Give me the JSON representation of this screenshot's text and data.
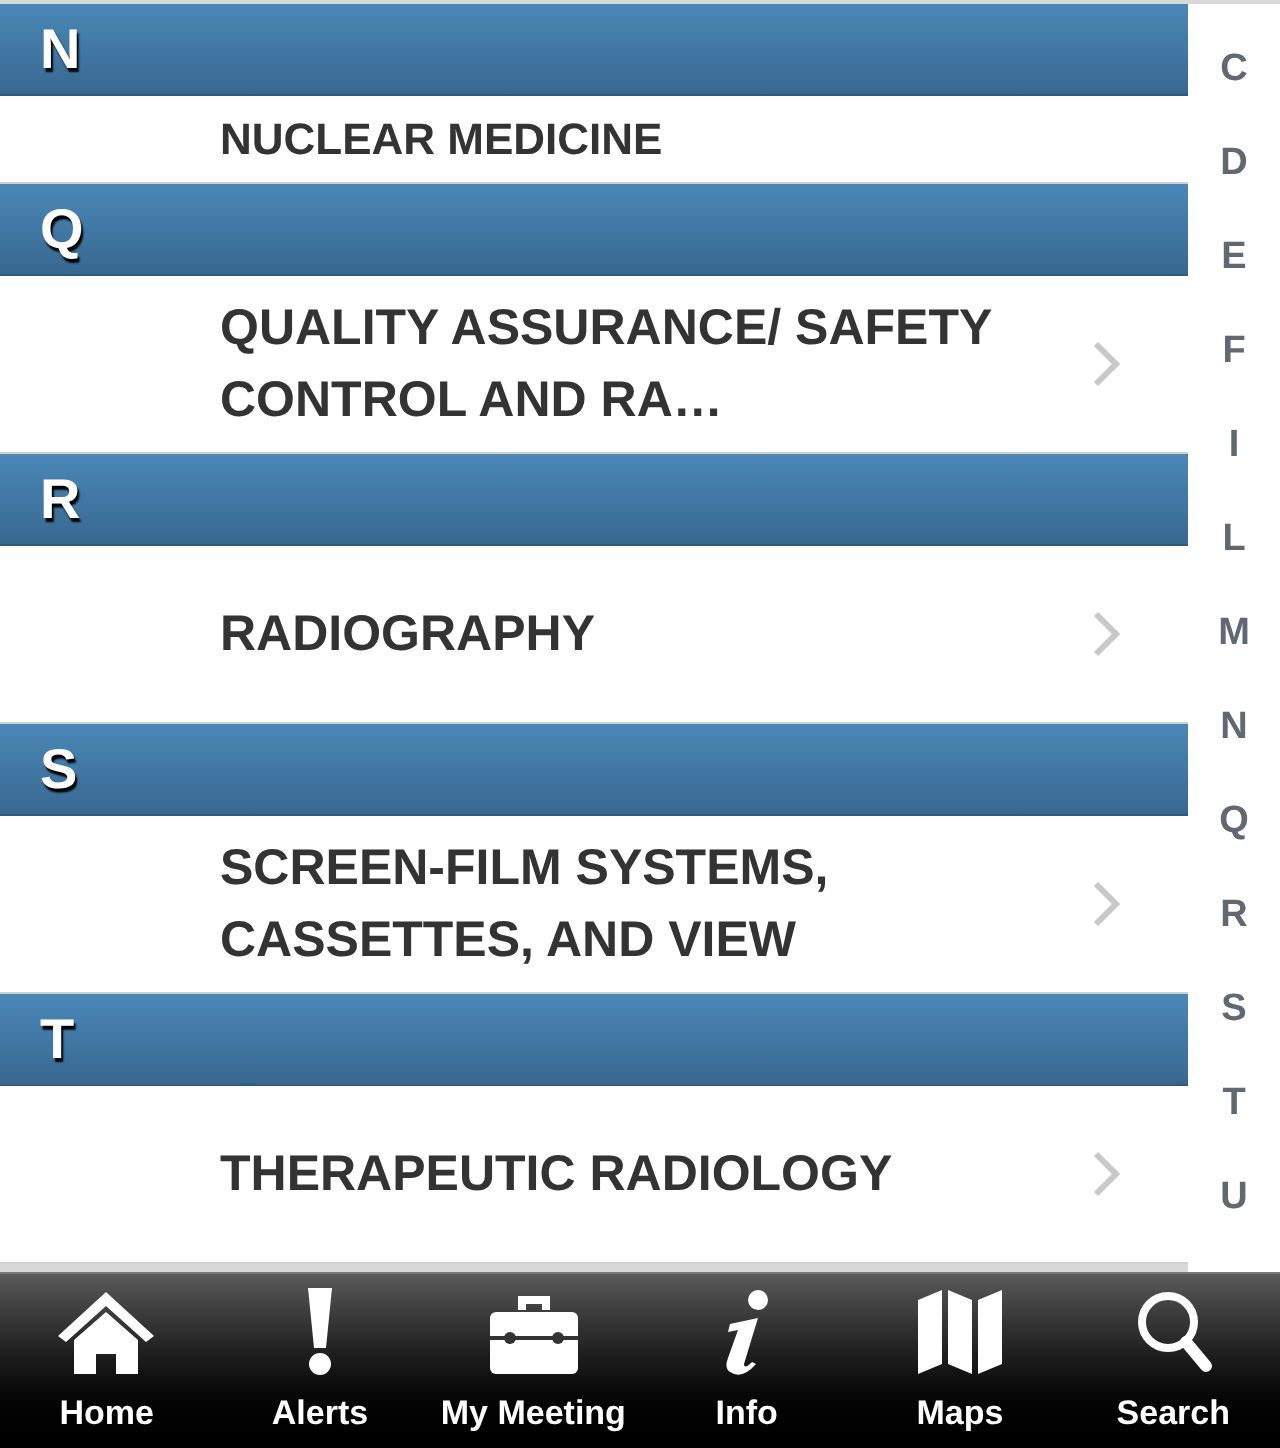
{
  "sections": [
    {
      "letter": "N",
      "items": [
        {
          "kind": "partial",
          "title": "NUCLEAR MEDICINE"
        }
      ]
    },
    {
      "letter": "Q",
      "items": [
        {
          "kind": "full",
          "title": "QUALITY ASSURANCE/ SAFETY CONTROL AND RA…"
        }
      ]
    },
    {
      "letter": "R",
      "items": [
        {
          "kind": "full",
          "title": "RADIOGRAPHY"
        }
      ]
    },
    {
      "letter": "S",
      "items": [
        {
          "kind": "full",
          "title": "SCREEN-FILM SYSTEMS, CASSETTES, AND VIEW"
        }
      ]
    },
    {
      "letter": "T",
      "items": [
        {
          "kind": "full",
          "title": "THERAPEUTIC RADIOLOGY"
        }
      ]
    }
  ],
  "index": [
    "C",
    "D",
    "E",
    "F",
    "I",
    "L",
    "M",
    "N",
    "Q",
    "R",
    "S",
    "T",
    "U"
  ],
  "tabs": [
    {
      "label": "Home"
    },
    {
      "label": "Alerts"
    },
    {
      "label": "My Meeting"
    },
    {
      "label": "Info"
    },
    {
      "label": "Maps"
    },
    {
      "label": "Search"
    }
  ]
}
